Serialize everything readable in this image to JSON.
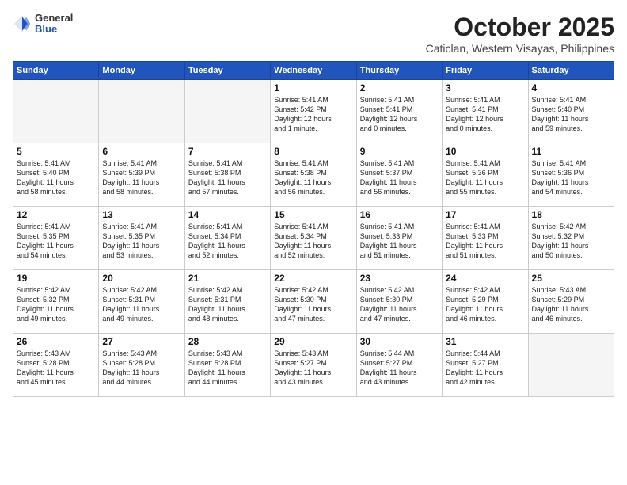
{
  "header": {
    "logo": {
      "general": "General",
      "blue": "Blue"
    },
    "month": "October 2025",
    "location": "Caticlan, Western Visayas, Philippines"
  },
  "weekdays": [
    "Sunday",
    "Monday",
    "Tuesday",
    "Wednesday",
    "Thursday",
    "Friday",
    "Saturday"
  ],
  "weeks": [
    [
      {
        "day": null,
        "info": null
      },
      {
        "day": null,
        "info": null
      },
      {
        "day": null,
        "info": null
      },
      {
        "day": "1",
        "info": "Sunrise: 5:41 AM\nSunset: 5:42 PM\nDaylight: 12 hours\nand 1 minute."
      },
      {
        "day": "2",
        "info": "Sunrise: 5:41 AM\nSunset: 5:41 PM\nDaylight: 12 hours\nand 0 minutes."
      },
      {
        "day": "3",
        "info": "Sunrise: 5:41 AM\nSunset: 5:41 PM\nDaylight: 12 hours\nand 0 minutes."
      },
      {
        "day": "4",
        "info": "Sunrise: 5:41 AM\nSunset: 5:40 PM\nDaylight: 11 hours\nand 59 minutes."
      }
    ],
    [
      {
        "day": "5",
        "info": "Sunrise: 5:41 AM\nSunset: 5:40 PM\nDaylight: 11 hours\nand 58 minutes."
      },
      {
        "day": "6",
        "info": "Sunrise: 5:41 AM\nSunset: 5:39 PM\nDaylight: 11 hours\nand 58 minutes."
      },
      {
        "day": "7",
        "info": "Sunrise: 5:41 AM\nSunset: 5:38 PM\nDaylight: 11 hours\nand 57 minutes."
      },
      {
        "day": "8",
        "info": "Sunrise: 5:41 AM\nSunset: 5:38 PM\nDaylight: 11 hours\nand 56 minutes."
      },
      {
        "day": "9",
        "info": "Sunrise: 5:41 AM\nSunset: 5:37 PM\nDaylight: 11 hours\nand 56 minutes."
      },
      {
        "day": "10",
        "info": "Sunrise: 5:41 AM\nSunset: 5:36 PM\nDaylight: 11 hours\nand 55 minutes."
      },
      {
        "day": "11",
        "info": "Sunrise: 5:41 AM\nSunset: 5:36 PM\nDaylight: 11 hours\nand 54 minutes."
      }
    ],
    [
      {
        "day": "12",
        "info": "Sunrise: 5:41 AM\nSunset: 5:35 PM\nDaylight: 11 hours\nand 54 minutes."
      },
      {
        "day": "13",
        "info": "Sunrise: 5:41 AM\nSunset: 5:35 PM\nDaylight: 11 hours\nand 53 minutes."
      },
      {
        "day": "14",
        "info": "Sunrise: 5:41 AM\nSunset: 5:34 PM\nDaylight: 11 hours\nand 52 minutes."
      },
      {
        "day": "15",
        "info": "Sunrise: 5:41 AM\nSunset: 5:34 PM\nDaylight: 11 hours\nand 52 minutes."
      },
      {
        "day": "16",
        "info": "Sunrise: 5:41 AM\nSunset: 5:33 PM\nDaylight: 11 hours\nand 51 minutes."
      },
      {
        "day": "17",
        "info": "Sunrise: 5:41 AM\nSunset: 5:33 PM\nDaylight: 11 hours\nand 51 minutes."
      },
      {
        "day": "18",
        "info": "Sunrise: 5:42 AM\nSunset: 5:32 PM\nDaylight: 11 hours\nand 50 minutes."
      }
    ],
    [
      {
        "day": "19",
        "info": "Sunrise: 5:42 AM\nSunset: 5:32 PM\nDaylight: 11 hours\nand 49 minutes."
      },
      {
        "day": "20",
        "info": "Sunrise: 5:42 AM\nSunset: 5:31 PM\nDaylight: 11 hours\nand 49 minutes."
      },
      {
        "day": "21",
        "info": "Sunrise: 5:42 AM\nSunset: 5:31 PM\nDaylight: 11 hours\nand 48 minutes."
      },
      {
        "day": "22",
        "info": "Sunrise: 5:42 AM\nSunset: 5:30 PM\nDaylight: 11 hours\nand 47 minutes."
      },
      {
        "day": "23",
        "info": "Sunrise: 5:42 AM\nSunset: 5:30 PM\nDaylight: 11 hours\nand 47 minutes."
      },
      {
        "day": "24",
        "info": "Sunrise: 5:42 AM\nSunset: 5:29 PM\nDaylight: 11 hours\nand 46 minutes."
      },
      {
        "day": "25",
        "info": "Sunrise: 5:43 AM\nSunset: 5:29 PM\nDaylight: 11 hours\nand 46 minutes."
      }
    ],
    [
      {
        "day": "26",
        "info": "Sunrise: 5:43 AM\nSunset: 5:28 PM\nDaylight: 11 hours\nand 45 minutes."
      },
      {
        "day": "27",
        "info": "Sunrise: 5:43 AM\nSunset: 5:28 PM\nDaylight: 11 hours\nand 44 minutes."
      },
      {
        "day": "28",
        "info": "Sunrise: 5:43 AM\nSunset: 5:28 PM\nDaylight: 11 hours\nand 44 minutes."
      },
      {
        "day": "29",
        "info": "Sunrise: 5:43 AM\nSunset: 5:27 PM\nDaylight: 11 hours\nand 43 minutes."
      },
      {
        "day": "30",
        "info": "Sunrise: 5:44 AM\nSunset: 5:27 PM\nDaylight: 11 hours\nand 43 minutes."
      },
      {
        "day": "31",
        "info": "Sunrise: 5:44 AM\nSunset: 5:27 PM\nDaylight: 11 hours\nand 42 minutes."
      },
      {
        "day": null,
        "info": null
      }
    ]
  ]
}
